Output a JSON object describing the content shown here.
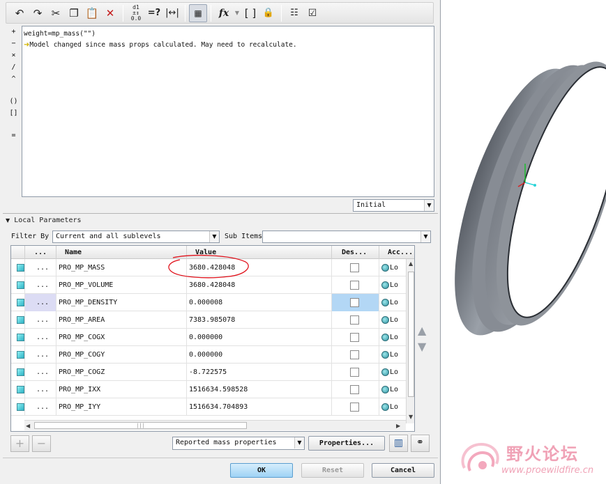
{
  "editor": {
    "operators": [
      "+",
      "−",
      "×",
      "/",
      "^",
      "()",
      "[]",
      "="
    ],
    "line1": "weight=mp_mass(\"\")",
    "line2": "Model changed since mass props calculated. May need to recalculate."
  },
  "mode_combo": "Initial",
  "section": {
    "title": "Local Parameters"
  },
  "filter": {
    "label": "Filter By",
    "value": "Current and all sublevels",
    "sub_items_label": "Sub Items",
    "sub_items_value": ""
  },
  "table": {
    "headers": {
      "dots": "...",
      "name": "Name",
      "value": "Value",
      "des": "Des...",
      "acc": "Acc..."
    },
    "rows": [
      {
        "dots": "...",
        "name": "PRO_MP_MASS",
        "value": "3680.428048",
        "acc": "Lo"
      },
      {
        "dots": "...",
        "name": "PRO_MP_VOLUME",
        "value": "3680.428048",
        "acc": "Lo"
      },
      {
        "dots": "...",
        "name": "PRO_MP_DENSITY",
        "value": "0.000008",
        "acc": "Lo"
      },
      {
        "dots": "...",
        "name": "PRO_MP_AREA",
        "value": "7383.985078",
        "acc": "Lo"
      },
      {
        "dots": "...",
        "name": "PRO_MP_COGX",
        "value": "0.000000",
        "acc": "Lo"
      },
      {
        "dots": "...",
        "name": "PRO_MP_COGY",
        "value": "0.000000",
        "acc": "Lo"
      },
      {
        "dots": "...",
        "name": "PRO_MP_COGZ",
        "value": "-8.722575",
        "acc": "Lo"
      },
      {
        "dots": "...",
        "name": "PRO_MP_IXX",
        "value": "1516634.598528",
        "acc": "Lo"
      },
      {
        "dots": "...",
        "name": "PRO_MP_IYY",
        "value": "1516634.704893",
        "acc": "Lo"
      }
    ]
  },
  "bottom": {
    "combo": "Reported mass properties",
    "properties_label": "Properties...",
    "ok_label": "OK",
    "reset_label": "Reset",
    "cancel_label": "Cancel"
  },
  "watermark": {
    "cn": "野火论坛",
    "url": "www.proewildfire.cn"
  },
  "colors": {
    "accent_button": "#9dd2f5",
    "selection": "#b3d7f5",
    "annotation": "#e0101a",
    "model_gray": "#7a8088"
  }
}
